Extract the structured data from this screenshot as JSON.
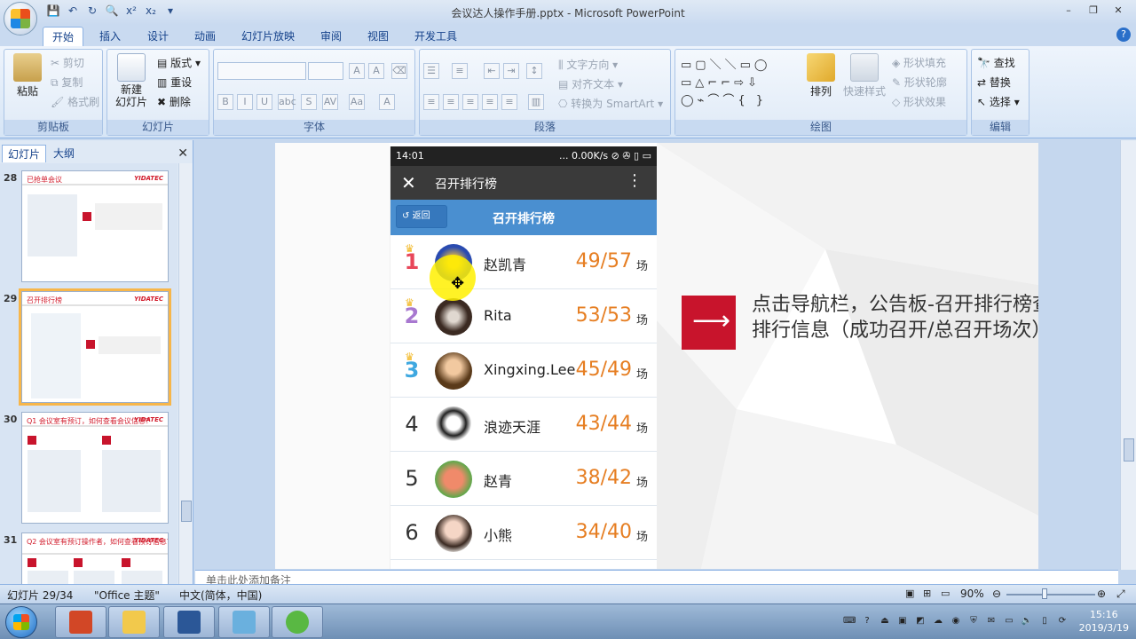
{
  "window": {
    "title": "会议达人操作手册.pptx - Microsoft PowerPoint",
    "controls": [
      "–",
      "❐",
      "✕"
    ]
  },
  "ribbon_tabs": [
    "开始",
    "插入",
    "设计",
    "动画",
    "幻灯片放映",
    "审阅",
    "视图",
    "开发工具"
  ],
  "ribbon": {
    "clipboard": {
      "label": "剪贴板",
      "paste": "粘贴",
      "cut": "剪切",
      "copy": "复制",
      "format_painter": "格式刷"
    },
    "slides": {
      "label": "幻灯片",
      "new_slide": "新建\n幻灯片",
      "layout": "版式",
      "reset": "重设",
      "delete": "删除"
    },
    "font": {
      "label": "字体"
    },
    "paragraph": {
      "label": "段落",
      "text_direction": "文字方向",
      "align_text": "对齐文本",
      "convert_smartart": "转换为 SmartArt"
    },
    "drawing": {
      "label": "绘图",
      "arrange": "排列",
      "quick_styles": "快速样式",
      "shape_fill": "形状填充",
      "shape_outline": "形状轮廓",
      "shape_effects": "形状效果"
    },
    "editing": {
      "label": "编辑",
      "find": "查找",
      "replace": "替换",
      "select": "选择"
    }
  },
  "left_panel": {
    "tabs": [
      "幻灯片",
      "大纲"
    ],
    "slides": [
      {
        "num": "28",
        "title": "已抢单会议",
        "brand": "YIDATEC"
      },
      {
        "num": "29",
        "title": "召开排行榜",
        "brand": "YIDATEC"
      },
      {
        "num": "30",
        "title": "Q1 会议室有预订，如何查看会议信息？",
        "brand": "YIDATEC"
      },
      {
        "num": "31",
        "title": "Q2 会议室有预订操作者，如何查看预订信息？",
        "brand": "YIDATEC"
      }
    ]
  },
  "phone": {
    "status_time": "14:01",
    "status_right": "... 0.00K/s ⊘ ✇ ▯ ▭",
    "appbar_title": "召开排行榜",
    "back_label": "返回",
    "subbar_title": "召开排行榜",
    "rankings": [
      {
        "rank": "1",
        "name": "赵凯青",
        "score": "49/57",
        "unit": "场",
        "color": "#e8475a"
      },
      {
        "rank": "2",
        "name": "Rita",
        "score": "53/53",
        "unit": "场",
        "color": "#a878d0"
      },
      {
        "rank": "3",
        "name": "Xingxing.Lee",
        "score": "45/49",
        "unit": "场",
        "color": "#3fa8e0"
      },
      {
        "rank": "4",
        "name": "浪迹天涯",
        "score": "43/44",
        "unit": "场",
        "color": "#333333"
      },
      {
        "rank": "5",
        "name": "赵青",
        "score": "38/42",
        "unit": "场",
        "color": "#333333"
      },
      {
        "rank": "6",
        "name": "小熊",
        "score": "34/40",
        "unit": "场",
        "color": "#333333"
      }
    ]
  },
  "slide_text": "点击导航栏，公告板-召开排行榜查看排行信息（成功召开/总召开场次）。",
  "notes_placeholder": "单击此处添加备注",
  "statusbar": {
    "slide_info": "幻灯片 29/34",
    "theme": "\"Office 主题\"",
    "language": "中文(简体，中国)",
    "zoom": "90%"
  },
  "taskbar": {
    "time": "15:16",
    "date": "2019/3/19"
  },
  "colors": {
    "accent_red": "#c8142c",
    "score_orange": "#e67e22",
    "ribbon_blue": "#4a8fd0"
  }
}
